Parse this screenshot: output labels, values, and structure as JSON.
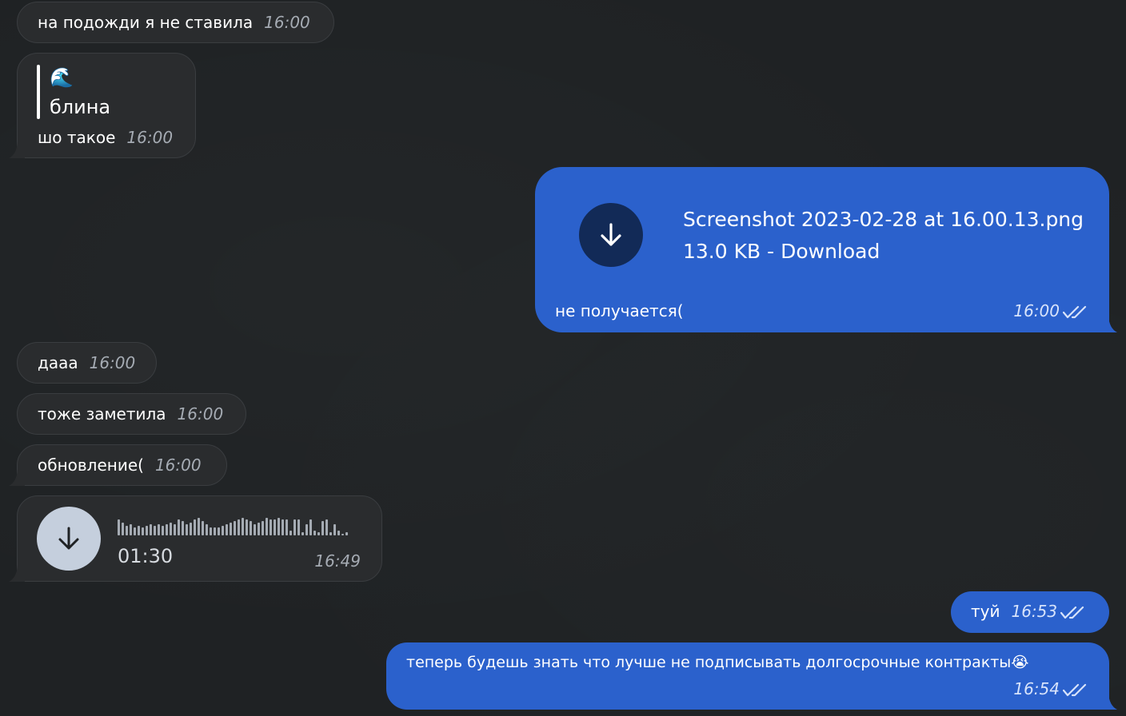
{
  "messages": {
    "m1": {
      "text": "на подожди я не ставила",
      "time": "16:00"
    },
    "m2": {
      "quote_emoji": "🌊",
      "quote_text": "блина",
      "text": "шо такое",
      "time": "16:00"
    },
    "m3": {
      "file_name": "Screenshot 2023-02-28 at 16.00.13.png",
      "file_meta": "13.0 KB - Download",
      "caption": "не получается(",
      "time": "16:00"
    },
    "m4": {
      "text": "дааа",
      "time": "16:00"
    },
    "m5": {
      "text": "тоже заметила",
      "time": "16:00"
    },
    "m6": {
      "text": "обновление(",
      "time": "16:00"
    },
    "m7": {
      "duration": "01:30",
      "time": "16:49"
    },
    "m8": {
      "text": "туй",
      "time": "16:53"
    },
    "m9": {
      "text": "теперь будешь знать что лучше не подписывать долгосрочные контракты😭",
      "time": "16:54"
    }
  },
  "icons": {
    "download": "download-arrow-icon",
    "read": "double-check-icon"
  },
  "colors": {
    "background": "#1f2224",
    "incoming_bubble": "#2a2c2e",
    "outgoing_bubble": "#2b61cc",
    "file_icon_circle": "#122a57",
    "voice_icon_circle": "#c5cfdd"
  }
}
